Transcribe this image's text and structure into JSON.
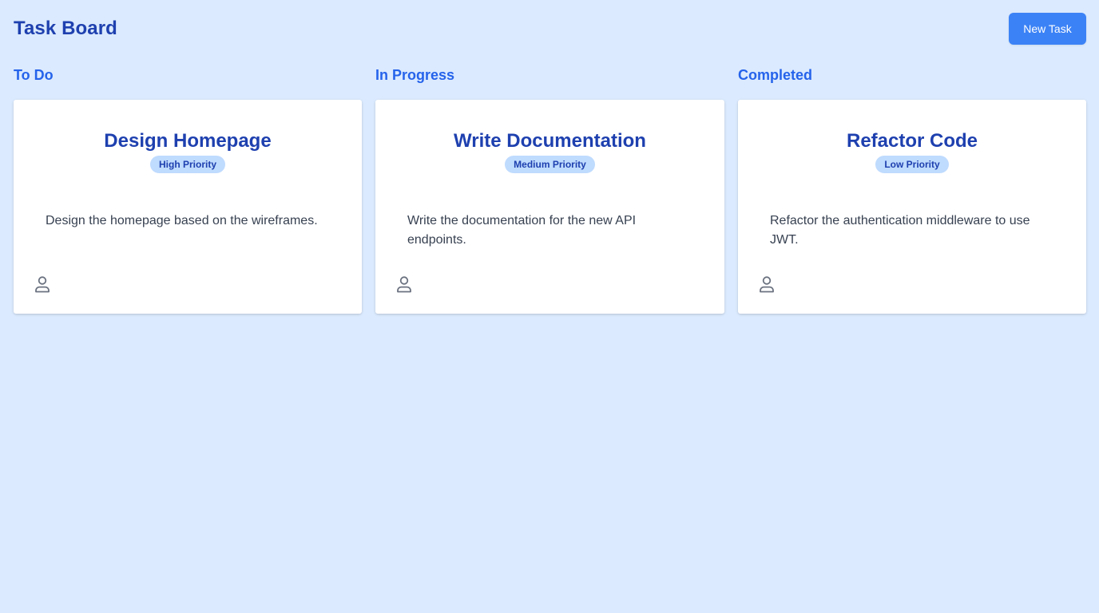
{
  "header": {
    "title": "Task Board",
    "new_task_label": "New Task"
  },
  "columns": [
    {
      "title": "To Do",
      "card": {
        "title": "Design Homepage",
        "priority": "High Priority",
        "description": "Design the homepage based on the wireframes.",
        "assignee_icon": "user-icon"
      }
    },
    {
      "title": "In Progress",
      "card": {
        "title": "Write Documentation",
        "priority": "Medium Priority",
        "description": "Write the documentation for the new API endpoints.",
        "assignee_icon": "user-icon"
      }
    },
    {
      "title": "Completed",
      "card": {
        "title": "Refactor Code",
        "priority": "Low Priority",
        "description": "Refactor the authentication middleware to use JWT.",
        "assignee_icon": "user-icon"
      }
    }
  ],
  "colors": {
    "background": "#dbeafe",
    "accent": "#3b82f6",
    "heading": "#1e40af",
    "column_heading": "#2563eb",
    "badge_bg": "#bfdbfe"
  }
}
